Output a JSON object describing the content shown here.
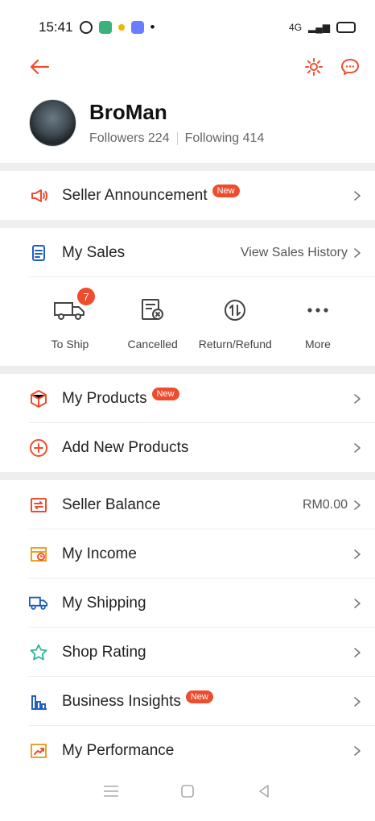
{
  "status": {
    "time": "15:41",
    "right_text": "4G"
  },
  "profile": {
    "name": "BroMan",
    "followers": "Followers 224",
    "following": "Following 414"
  },
  "announcement": {
    "label": "Seller Announcement",
    "badge": "New"
  },
  "my_sales": {
    "label": "My Sales",
    "link": "View Sales History"
  },
  "quick_actions": [
    {
      "label": "To Ship",
      "count": "7"
    },
    {
      "label": "Cancelled"
    },
    {
      "label": "Return/Refund"
    },
    {
      "label": "More"
    }
  ],
  "products": {
    "label": "My Products",
    "badge": "New"
  },
  "add_products": {
    "label": "Add New Products"
  },
  "balance": {
    "label": "Seller Balance",
    "value": "RM0.00"
  },
  "income": {
    "label": "My Income"
  },
  "shipping": {
    "label": "My Shipping"
  },
  "rating": {
    "label": "Shop Rating"
  },
  "insights": {
    "label": "Business Insights",
    "badge": "New"
  },
  "performance": {
    "label": "My Performance"
  },
  "colors": {
    "accent": "#ee4d2d"
  }
}
